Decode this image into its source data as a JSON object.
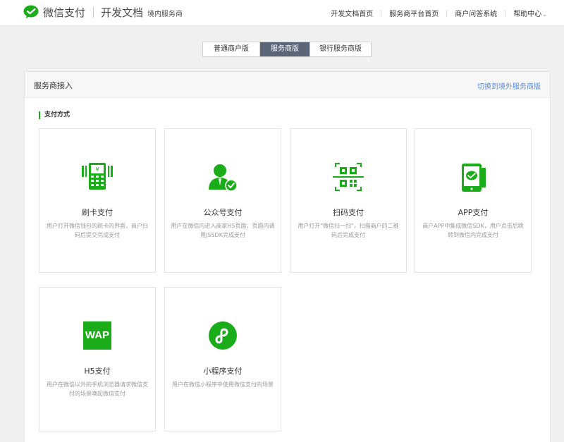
{
  "header": {
    "brand_name": "微信支付",
    "doc_title": "开发文档",
    "doc_subtitle": "境内服务商",
    "nav": [
      {
        "label": "开发文档首页"
      },
      {
        "label": "服务商平台首页"
      },
      {
        "label": "商户问答系统"
      },
      {
        "label": "帮助中心"
      }
    ]
  },
  "tabs": [
    {
      "label": "普通商户版",
      "active": false
    },
    {
      "label": "服务商版",
      "active": true
    },
    {
      "label": "银行服务商版",
      "active": false
    }
  ],
  "panel": {
    "title": "服务商接入",
    "switch_link": "切换到境外服务商版",
    "section_title": "支付方式",
    "cards": [
      {
        "icon": "card-terminal-icon",
        "title": "刷卡支付",
        "desc": "用户打开微信钱包的刷卡的界面，商户扫码后提交完成支付"
      },
      {
        "icon": "official-account-icon",
        "title": "公众号支付",
        "desc": "用户在微信内进入商家H5页面，页面内调用JSSDK完成支付"
      },
      {
        "icon": "qr-scan-icon",
        "title": "扫码支付",
        "desc": "用户打开\"微信扫一扫\"，扫描商户的二维码后完成支付"
      },
      {
        "icon": "app-phone-icon",
        "title": "APP支付",
        "desc": "商户APP中集成微信SDK，用户点击后跳转到微信内完成支付"
      },
      {
        "icon": "wap-icon",
        "title": "H5支付",
        "desc": "用户在微信以外的手机浏览器请求微信支付的场景唤起微信支付"
      },
      {
        "icon": "mini-program-icon",
        "title": "小程序支付",
        "desc": "用户在微信小程序中使用微信支付的场景"
      }
    ]
  },
  "colors": {
    "brand_green": "#1aad19",
    "active_tab": "#5a6578",
    "link_blue": "#5b8bd4"
  }
}
